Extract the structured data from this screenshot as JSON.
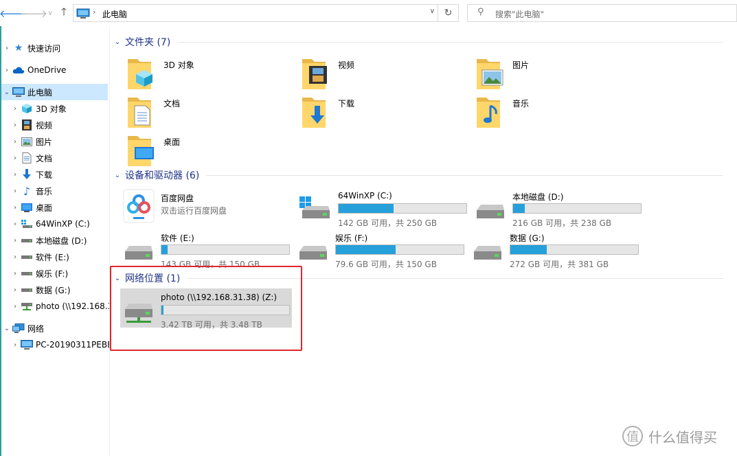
{
  "toolbar": {
    "back_icon": "arrow-left-icon",
    "forward_icon": "arrow-right-icon",
    "recent_icon": "chevron-down-icon",
    "up_icon": "arrow-up-icon",
    "address": "此电脑",
    "search_placeholder": "搜索\"此电脑\""
  },
  "sidebar": {
    "items": [
      {
        "label": "快速访问",
        "icon": "star-icon"
      },
      {
        "label": "OneDrive",
        "icon": "cloud-icon"
      },
      {
        "label": "此电脑",
        "icon": "computer-icon"
      },
      {
        "label": "3D 对象",
        "icon": "cube-icon"
      },
      {
        "label": "视频",
        "icon": "film-icon"
      },
      {
        "label": "图片",
        "icon": "picture-icon"
      },
      {
        "label": "文档",
        "icon": "document-icon"
      },
      {
        "label": "下载",
        "icon": "download-icon"
      },
      {
        "label": "音乐",
        "icon": "music-icon"
      },
      {
        "label": "桌面",
        "icon": "desktop-icon"
      },
      {
        "label": "64WinXP  (C:)",
        "icon": "windows-drive-icon"
      },
      {
        "label": "本地磁盘 (D:)",
        "icon": "drive-icon"
      },
      {
        "label": "软件 (E:)",
        "icon": "drive-icon"
      },
      {
        "label": "娱乐 (F:)",
        "icon": "drive-icon"
      },
      {
        "label": "数据 (G:)",
        "icon": "drive-icon"
      },
      {
        "label": "photo (\\\\192.168.3",
        "icon": "network-drive-icon"
      },
      {
        "label": "网络",
        "icon": "network-icon"
      },
      {
        "label": "PC-20190311PEBE",
        "icon": "computer-icon"
      }
    ]
  },
  "groups": {
    "folders": {
      "title": "文件夹 (7)",
      "items": [
        {
          "label": "3D 对象",
          "icon": "3d-objects-folder-icon"
        },
        {
          "label": "视频",
          "icon": "videos-folder-icon"
        },
        {
          "label": "图片",
          "icon": "pictures-folder-icon"
        },
        {
          "label": "文档",
          "icon": "documents-folder-icon"
        },
        {
          "label": "下载",
          "icon": "downloads-folder-icon"
        },
        {
          "label": "音乐",
          "icon": "music-folder-icon"
        },
        {
          "label": "桌面",
          "icon": "desktop-folder-icon"
        }
      ]
    },
    "devices": {
      "title": "设备和驱动器 (6)",
      "app": {
        "label": "百度网盘",
        "sub": "双击运行百度网盘",
        "icon": "baidu-netdisk-icon"
      },
      "drives": [
        {
          "label": "64WinXP  (C:)",
          "size": "142 GB 可用，共 250 GB",
          "used_fraction": 0.432,
          "icon": "windows-drive-icon"
        },
        {
          "label": "本地磁盘 (D:)",
          "size": "216 GB 可用，共 238 GB",
          "used_fraction": 0.092,
          "icon": "drive-icon"
        },
        {
          "label": "软件 (E:)",
          "size": "143 GB 可用，共 150 GB",
          "used_fraction": 0.047,
          "icon": "drive-icon"
        },
        {
          "label": "娱乐 (F:)",
          "size": "79.6 GB 可用，共 150 GB",
          "used_fraction": 0.469,
          "icon": "drive-icon"
        },
        {
          "label": "数据 (G:)",
          "size": "272 GB 可用，共 381 GB",
          "used_fraction": 0.286,
          "icon": "drive-icon"
        }
      ]
    },
    "network": {
      "title": "网络位置 (1)",
      "drive": {
        "label": "photo (\\\\192.168.31.38) (Z:)",
        "size": "3.42 TB 可用，共 3.48 TB",
        "used_fraction": 0.017,
        "icon": "network-drive-icon"
      }
    }
  },
  "watermark": {
    "text": "什么值得买",
    "logo": "值"
  },
  "colors": {
    "accent": "#26a0da",
    "selection": "#cce8ff",
    "highlight_box": "#e0262b",
    "group_title": "#1e3287"
  }
}
